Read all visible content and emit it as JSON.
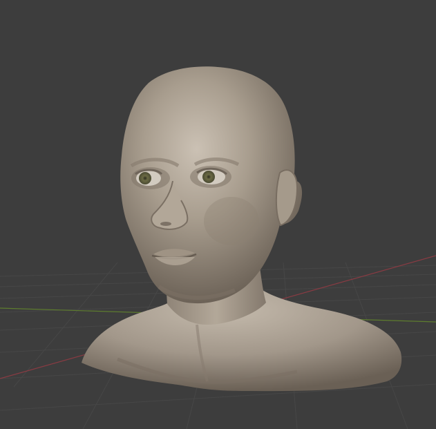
{
  "viewport": {
    "background": "#3d3d3d",
    "grid_color": "#4a4a4a",
    "axis_x_color": "#8a3b43",
    "axis_y_color": "#5e7d2e",
    "model": {
      "subject": "sculpted-head-bust",
      "clay_color": "#a59a8b",
      "clay_shadow": "#6f655a",
      "clay_highlight": "#c8beb1",
      "iris_color": "#6b6a44"
    }
  }
}
